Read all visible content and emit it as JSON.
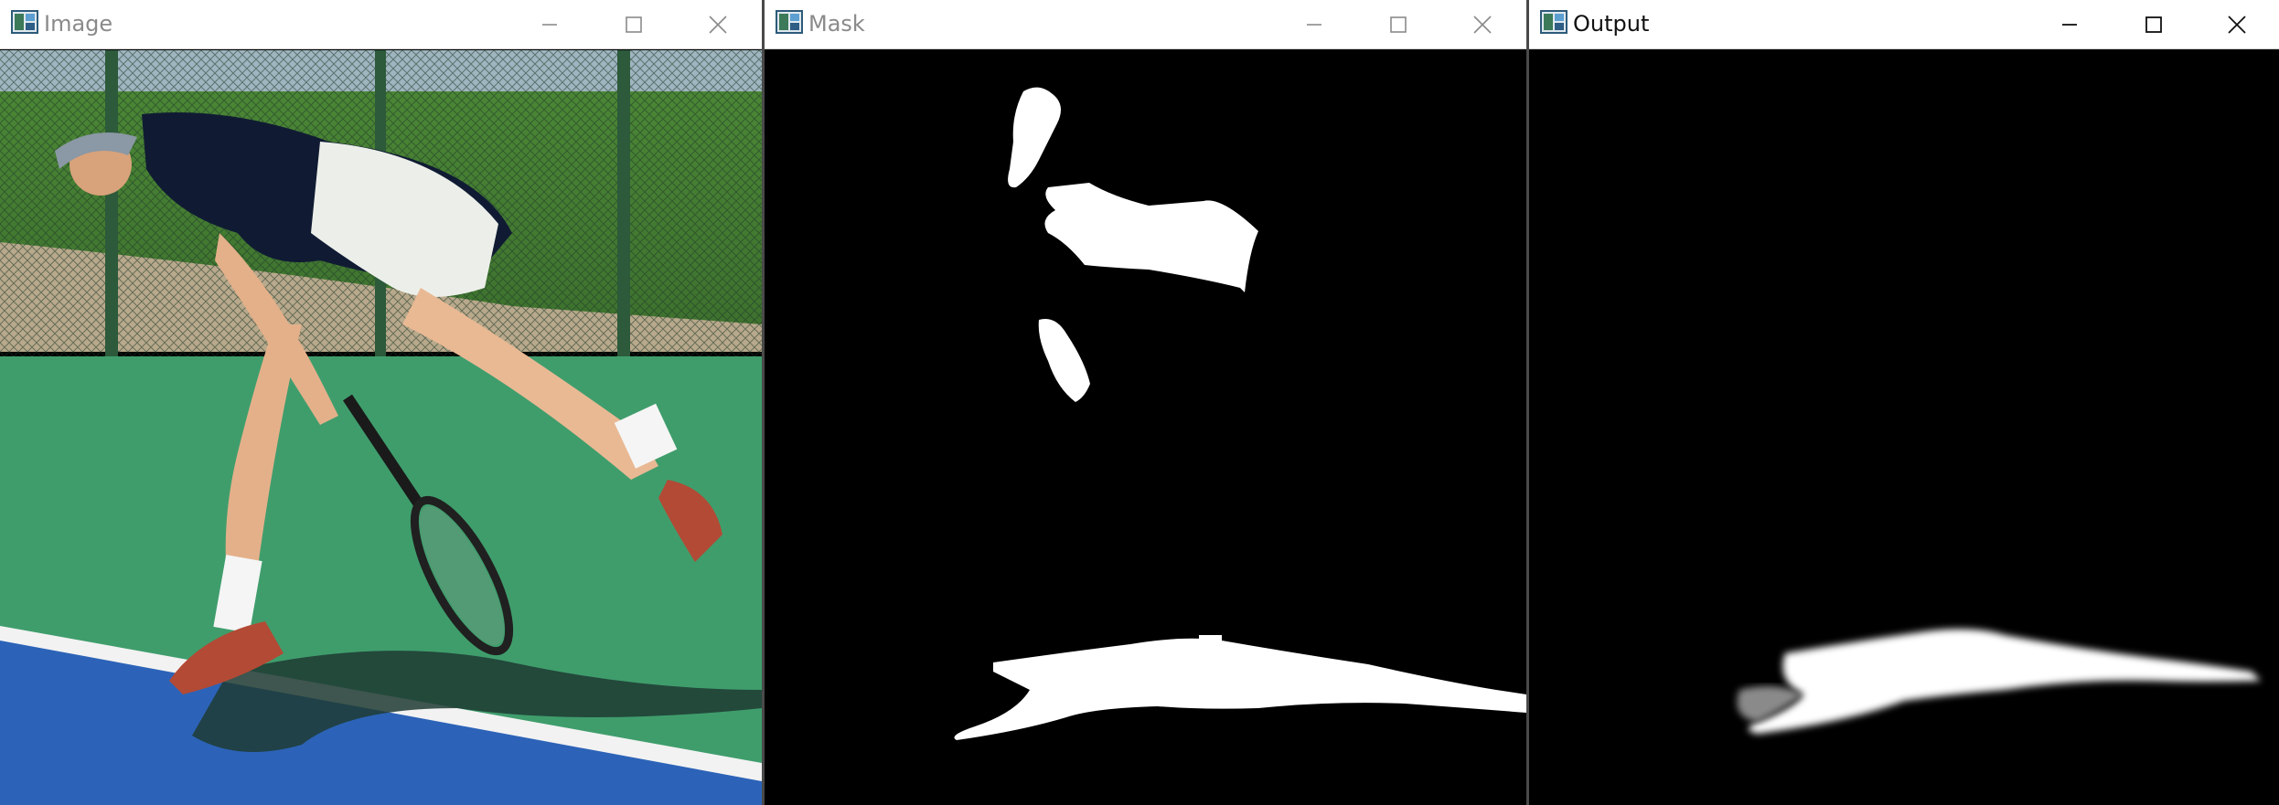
{
  "windows": [
    {
      "title": "Image",
      "active": false
    },
    {
      "title": "Mask",
      "active": false
    },
    {
      "title": "Output",
      "active": true
    }
  ],
  "colors": {
    "inactive_text": "#8a8a8a",
    "active_text": "#111111",
    "court_green": "#3f9d6c",
    "court_blue": "#2c63b8"
  },
  "icons": [
    "app-window-icon",
    "minimize-icon",
    "maximize-icon",
    "close-icon"
  ]
}
